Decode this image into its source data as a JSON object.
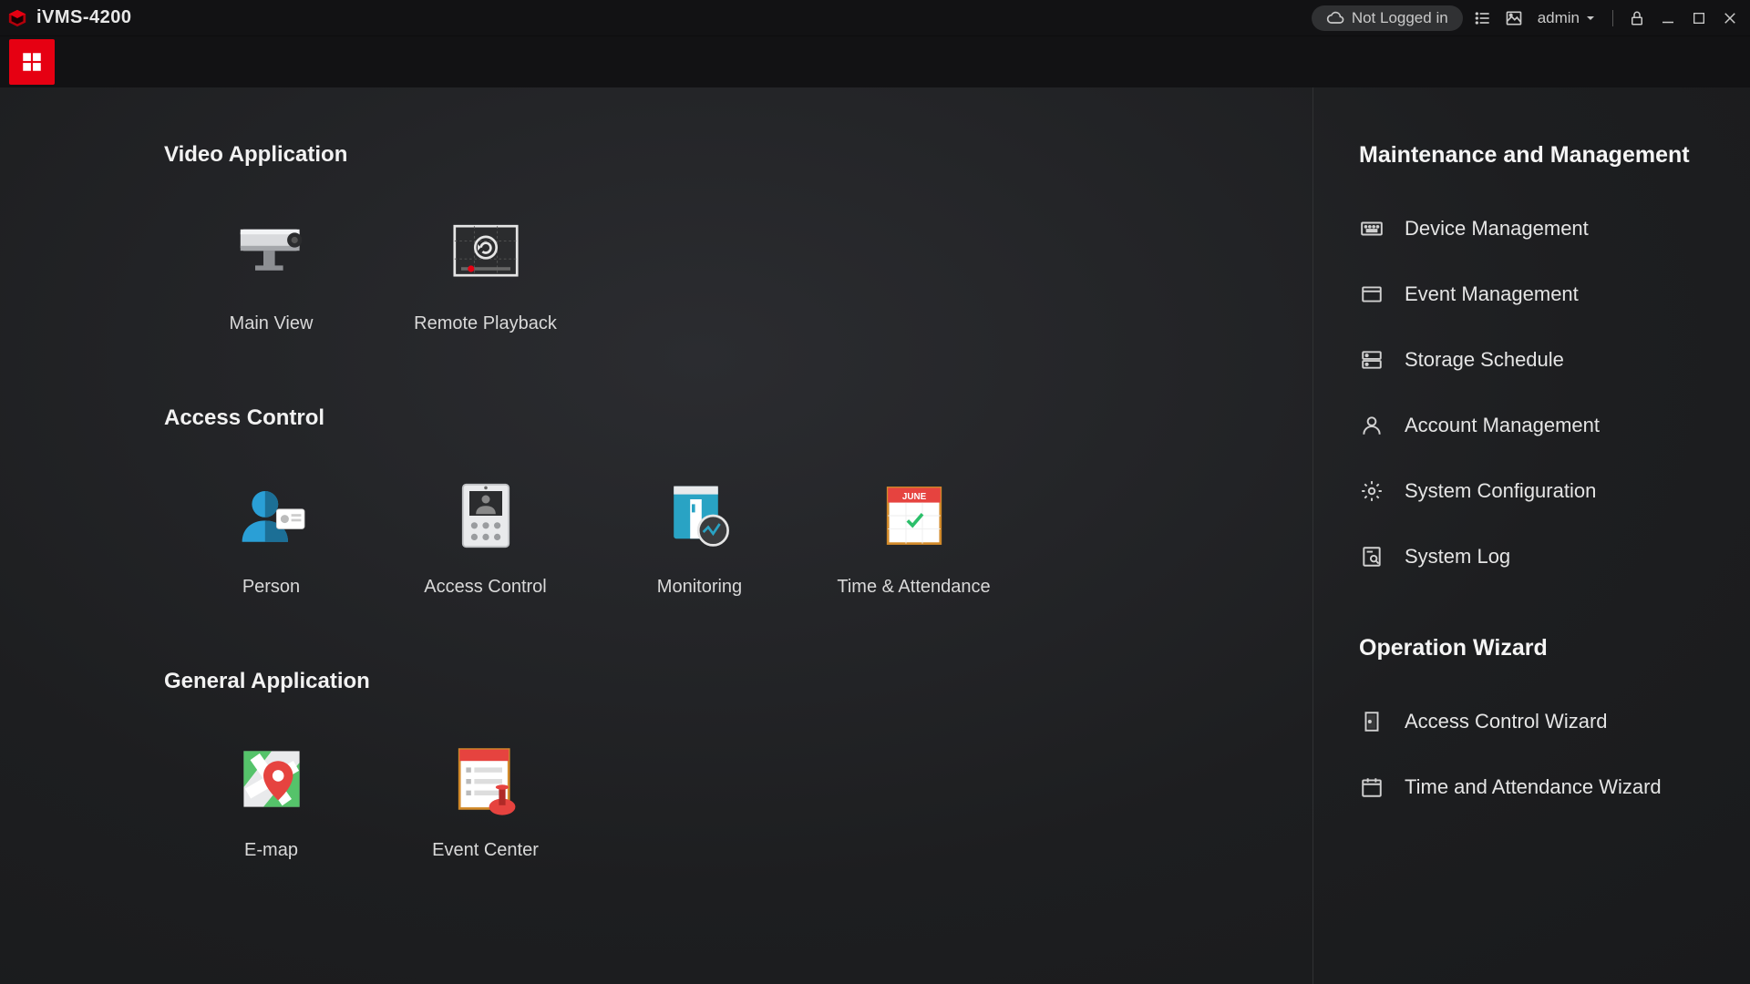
{
  "titlebar": {
    "app_title": "iVMS-4200",
    "login_status": "Not Logged in",
    "user_label": "admin"
  },
  "sections": {
    "video": {
      "heading": "Video Application",
      "items": [
        {
          "label": "Main View"
        },
        {
          "label": "Remote Playback"
        }
      ]
    },
    "access": {
      "heading": "Access Control",
      "items": [
        {
          "label": "Person"
        },
        {
          "label": "Access Control"
        },
        {
          "label": "Monitoring"
        },
        {
          "label": "Time & Attendance"
        }
      ]
    },
    "general": {
      "heading": "General Application",
      "items": [
        {
          "label": "E-map"
        },
        {
          "label": "Event Center"
        }
      ]
    }
  },
  "right_panel": {
    "group1": {
      "heading": "Maintenance and Management",
      "items": [
        {
          "label": "Device Management"
        },
        {
          "label": "Event Management"
        },
        {
          "label": "Storage Schedule"
        },
        {
          "label": "Account Management"
        },
        {
          "label": "System Configuration"
        },
        {
          "label": "System Log"
        }
      ]
    },
    "group2": {
      "heading": "Operation Wizard",
      "items": [
        {
          "label": "Access Control Wizard"
        },
        {
          "label": "Time and Attendance Wizard"
        }
      ]
    }
  }
}
